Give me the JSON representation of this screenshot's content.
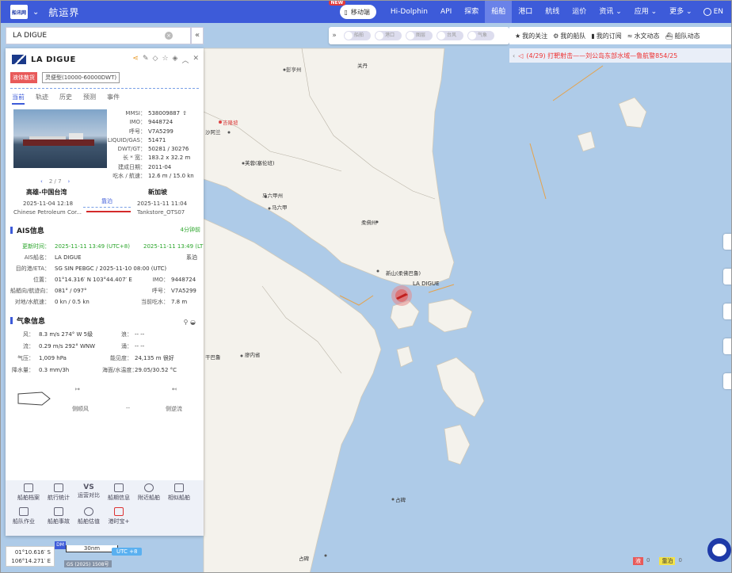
{
  "app": {
    "brand": "航运界",
    "logo_text": "船讯网",
    "nav": {
      "new_badge": "NEW",
      "mobile": "移动端",
      "items": [
        "Hi-Dolphin",
        "API",
        "探索",
        "船舶",
        "港口",
        "航线",
        "运价",
        "资讯",
        "应用",
        "更多"
      ],
      "active": "船舶",
      "lang": "EN"
    }
  },
  "search": {
    "value": "LA DIGUE"
  },
  "layers": [
    "船舶",
    "港口",
    "图层",
    "台风",
    "气象"
  ],
  "toolbar": [
    "我的关注",
    "我的船队",
    "我的订阅",
    "水文动态",
    "船队动态"
  ],
  "notice": "(4/29) 打靶射击——刘公岛东部水域—鲁航警854/25",
  "ship": {
    "name": "LA DIGUE",
    "tag_type": "液体散货",
    "tag_size": "灵便型(10000-60000DWT)",
    "tabs": [
      "当前",
      "轨迹",
      "历史",
      "预测",
      "事件"
    ],
    "active_tab": "当前",
    "specs": [
      {
        "k": "MMSI：",
        "v": "538009887"
      },
      {
        "k": "IMO：",
        "v": "9448724"
      },
      {
        "k": "呼号：",
        "v": "V7A5299"
      },
      {
        "k": "LIQUID/GAS：",
        "v": "51471"
      },
      {
        "k": "DWT/GT：",
        "v": "50281 / 30276"
      },
      {
        "k": "长 * 宽：",
        "v": "183.2 x 32.2 m"
      },
      {
        "k": "建成日期：",
        "v": "2011-04"
      },
      {
        "k": "吃水 / 航速：",
        "v": "12.6 m / 15.0 kn"
      }
    ],
    "pager": "2 / 7",
    "route": {
      "from_port": "高雄-中国台湾",
      "from_time": "2025-11-04 12:18",
      "from_name": "Chinese Petroleum Cor...",
      "to_port": "新加坡",
      "to_time": "2025-11-11 11:04",
      "to_name": "Tankstore_OTS07",
      "status": "靠泊"
    }
  },
  "ais": {
    "title": "AIS信息",
    "ago": "4分钟前",
    "update_label": "更新时间：",
    "update_utc": "2025-11-11 13:49 (UTC+8)",
    "update_lt": "2025-11-11 13:49 (LT)",
    "rows": [
      {
        "k": "AIS船名：",
        "v": "LA DIGUE",
        "k2": "",
        "v2": "系泊"
      },
      {
        "k": "目的港/ETA：",
        "v": "SG SIN PEBGC / 2025-11-10 08:00 (UTC)",
        "k2": "",
        "v2": ""
      },
      {
        "k": "位置：",
        "v": "01°14.316′ N   103°44.407′ E",
        "k2": "IMO：",
        "v2": "9448724"
      },
      {
        "k": "船艏向/航迹向：",
        "v": "081° / 097°",
        "k2": "呼号：",
        "v2": "V7A5299"
      },
      {
        "k": "对地/水航速：",
        "v": "0 kn / 0.5 kn",
        "k2": "当前吃水：",
        "v2": "7.8 m"
      }
    ]
  },
  "weather": {
    "title": "气象信息",
    "rows": [
      {
        "k": "风：",
        "v": "8.3 m/s 274° W 5级",
        "k2": "浪：",
        "v2": "-- --"
      },
      {
        "k": "流：",
        "v": "0.29 m/s 292° WNW",
        "k2": "涌：",
        "v2": "-- --"
      },
      {
        "k": "气压：",
        "v": "1,009 hPa",
        "k2": "能见度：",
        "v2": "24,135 m 很好"
      },
      {
        "k": "降水量：",
        "v": "0.3 mm/3h",
        "k2": "海面/水温度：",
        "v2": "29.05/30.52 °C"
      }
    ],
    "bottom": [
      "侧顺风",
      "--",
      "侧逆流"
    ]
  },
  "tools": [
    "船舶档案",
    "航行统计",
    "运营对比",
    "船期信息",
    "附近船舶",
    "相似船舶",
    "船队作业",
    "船舶事故",
    "船舶估值",
    "港时宝+"
  ],
  "tools_icon_text": "VS",
  "coords": {
    "lat": "01°10.616′ S",
    "lon": "106°14.271′ E"
  },
  "scale": {
    "dm": "DM",
    "label": "30nm",
    "utc": "UTC +8",
    "gs": "GS (2025) 1508号"
  },
  "legend": [
    {
      "label": "液",
      "value": "0"
    },
    {
      "label": "靠泊",
      "value": "0"
    }
  ],
  "map_labels": [
    {
      "t": "关丹"
    },
    {
      "t": "彭亨州"
    },
    {
      "t": "吉隆坡"
    },
    {
      "t": "沙阿兰"
    },
    {
      "t": "芙蓉(塞伦班)"
    },
    {
      "t": "马六甲州"
    },
    {
      "t": "马六甲"
    },
    {
      "t": "柔佛州"
    },
    {
      "t": "新山(柔佛巴鲁)"
    },
    {
      "t": "LA DIGUE"
    },
    {
      "t": "干巴鲁"
    },
    {
      "t": "廖内省"
    },
    {
      "t": "占碑"
    },
    {
      "t": "占碑"
    }
  ]
}
